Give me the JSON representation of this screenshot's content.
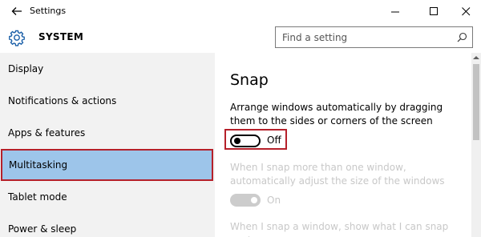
{
  "window": {
    "title": "Settings",
    "back_icon": "arrow-left-icon",
    "controls": [
      "minimize-icon",
      "maximize-icon",
      "close-icon"
    ]
  },
  "header": {
    "section_title": "SYSTEM",
    "section_icon": "gear-icon",
    "search": {
      "placeholder": "Find a setting",
      "value": "",
      "icon": "search-icon"
    }
  },
  "sidebar": {
    "items": [
      {
        "label": "Display",
        "selected": false
      },
      {
        "label": "Notifications & actions",
        "selected": false
      },
      {
        "label": "Apps & features",
        "selected": false
      },
      {
        "label": "Multitasking",
        "selected": true
      },
      {
        "label": "Tablet mode",
        "selected": false
      },
      {
        "label": "Power & sleep",
        "selected": false
      }
    ],
    "selected_color": "#9dc5ea"
  },
  "main": {
    "title": "Snap",
    "snap_description": "Arrange windows automatically by dragging them to the sides or corners of the screen",
    "snap_toggle": {
      "state": "Off",
      "on": false
    },
    "option_resize": "When I snap more than one window, automatically adjust the size of the windows",
    "resize_toggle": {
      "state": "On",
      "on": true,
      "enabled": false
    },
    "option_show": "When I snap a window, show what I can snap next"
  },
  "colors": {
    "highlight_border": "#b5202a",
    "disabled_text": "#c8c8c8"
  }
}
